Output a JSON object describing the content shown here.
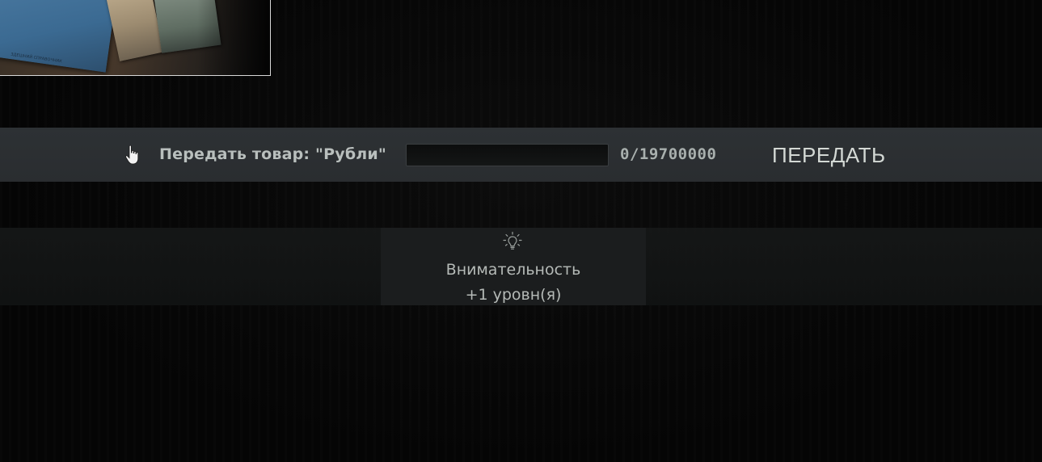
{
  "quest_image": {
    "icon": "documents-and-money-photo",
    "doc_caption": "ЗДЕШНИЙ СПРАВОЧНИК"
  },
  "handover": {
    "hand_icon": "hand-pointer-icon",
    "label": "Передать товар: \"Рубли\"",
    "input_value": "",
    "input_placeholder": "",
    "counter": "0/19700000",
    "submit_label": "ПЕРЕДАТЬ"
  },
  "reward": {
    "icon": "lightbulb-icon",
    "skill": "Внимательность",
    "level": "+1 уровн(я)"
  },
  "colors": {
    "bar_bg": "#2b2f32",
    "text": "#b9bfbd",
    "button_text": "#d3d8d4",
    "background": "#050505"
  }
}
